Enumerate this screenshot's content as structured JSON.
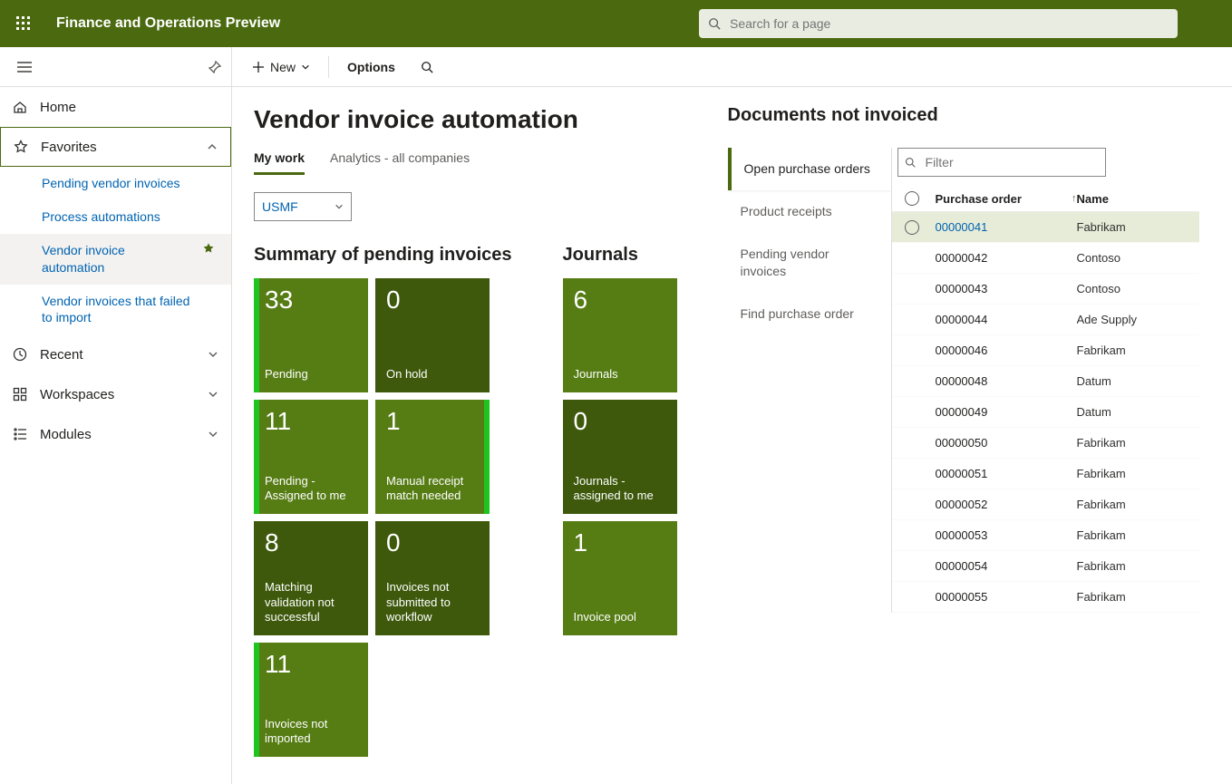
{
  "app_title": "Finance and Operations Preview",
  "search_placeholder": "Search for a page",
  "nav": {
    "home": "Home",
    "favorites": "Favorites",
    "fav_items": [
      "Pending vendor invoices",
      "Process automations",
      "Vendor invoice automation",
      "Vendor invoices that failed to import"
    ],
    "recent": "Recent",
    "workspaces": "Workspaces",
    "modules": "Modules"
  },
  "actions": {
    "new": "New",
    "options": "Options"
  },
  "page_title": "Vendor invoice automation",
  "tabs": {
    "my_work": "My work",
    "analytics": "Analytics - all companies"
  },
  "company": "USMF",
  "sections": {
    "summary_title": "Summary of pending invoices",
    "journals_title": "Journals",
    "docs_title": "Documents not invoiced"
  },
  "summary_tiles": [
    {
      "count": "33",
      "label": "Pending",
      "light": true,
      "accent": "left"
    },
    {
      "count": "0",
      "label": "On hold",
      "light": false
    },
    {
      "count": "11",
      "label": "Pending - Assigned to me",
      "light": true,
      "accent": "left"
    },
    {
      "count": "1",
      "label": "Manual receipt match needed",
      "light": true,
      "accent": "right"
    },
    {
      "count": "8",
      "label": "Matching validation not successful",
      "light": false
    },
    {
      "count": "0",
      "label": "Invoices not submitted to workflow",
      "light": false
    },
    {
      "count": "11",
      "label": "Invoices not imported",
      "light": true,
      "accent": "left"
    }
  ],
  "journal_tiles": [
    {
      "count": "6",
      "label": "Journals",
      "light": true
    },
    {
      "count": "0",
      "label": "Journals - assigned to me",
      "light": false
    },
    {
      "count": "1",
      "label": "Invoice pool",
      "light": true
    }
  ],
  "docs": {
    "tabs": [
      "Open purchase orders",
      "Product receipts",
      "Pending vendor invoices",
      "Find purchase order"
    ],
    "filter_placeholder": "Filter",
    "headers": {
      "po": "Purchase order",
      "name": "Name"
    },
    "rows": [
      {
        "po": "00000041",
        "name": "Fabrikam"
      },
      {
        "po": "00000042",
        "name": "Contoso"
      },
      {
        "po": "00000043",
        "name": "Contoso"
      },
      {
        "po": "00000044",
        "name": "Ade Supply"
      },
      {
        "po": "00000046",
        "name": "Fabrikam"
      },
      {
        "po": "00000048",
        "name": "Datum"
      },
      {
        "po": "00000049",
        "name": "Datum"
      },
      {
        "po": "00000050",
        "name": "Fabrikam"
      },
      {
        "po": "00000051",
        "name": "Fabrikam"
      },
      {
        "po": "00000052",
        "name": "Fabrikam"
      },
      {
        "po": "00000053",
        "name": "Fabrikam"
      },
      {
        "po": "00000054",
        "name": "Fabrikam"
      },
      {
        "po": "00000055",
        "name": "Fabrikam"
      }
    ]
  }
}
